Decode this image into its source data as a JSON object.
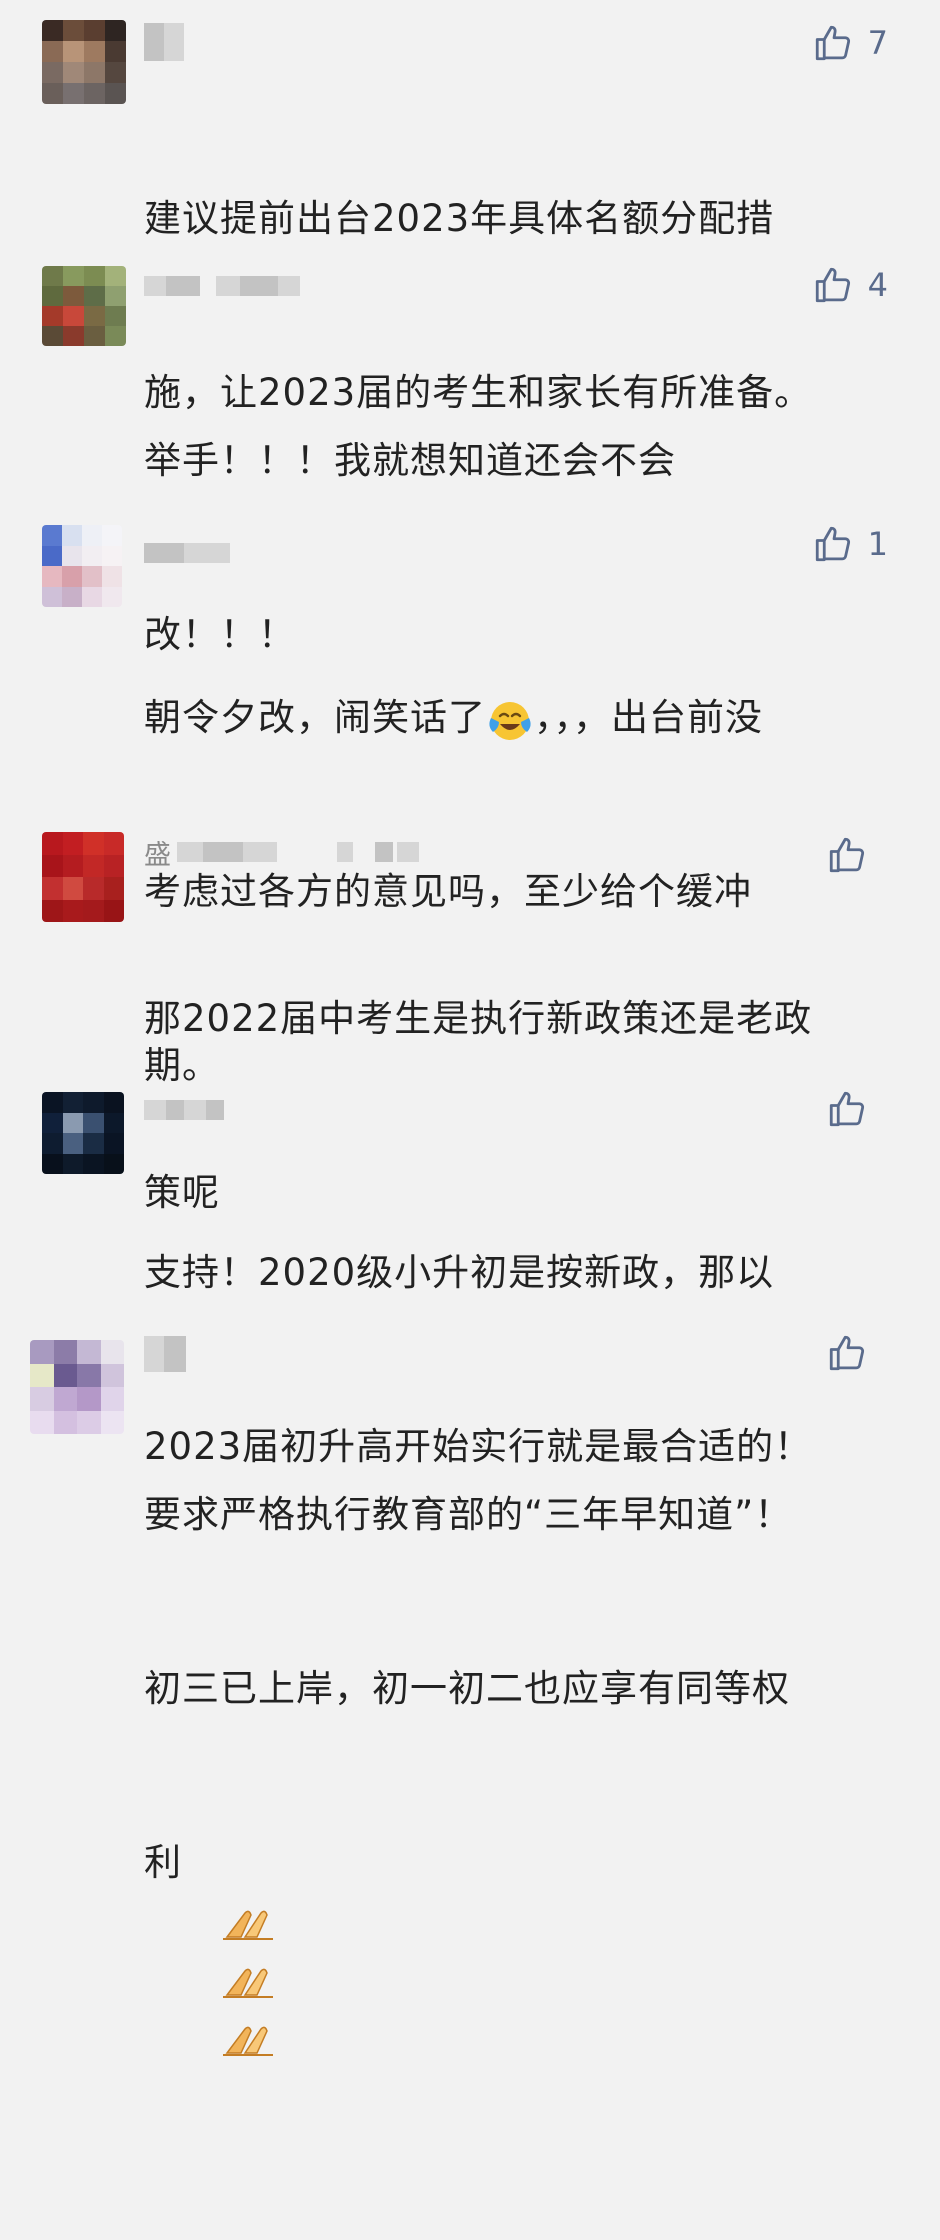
{
  "comments": [
    {
      "likes": "7",
      "lines": [
        "建议提前出台2023年具体名额分配措",
        "施，让2023届的考生和家长有所准备。"
      ]
    },
    {
      "likes": "4",
      "lines": [
        "举手！！！我就想知道还会不会",
        "改！！！"
      ]
    },
    {
      "likes": "1",
      "line1_a": "朝令夕改，闹笑话了",
      "line1_b": "，，，出台前没",
      "line1_emoji": "face-with-tears-of-joy-emoji",
      "lines": [
        "考虑过各方的意见吗，至少给个缓冲",
        "期。"
      ]
    },
    {
      "likes": "",
      "nickname": "盛",
      "lines": [
        "那2022届中考生是执行新政策还是老政",
        "策呢"
      ]
    },
    {
      "likes": "",
      "lines": [
        "支持！2020级小升初是按新政，那以",
        "2023届初升高开始实行就是最合适的！"
      ]
    },
    {
      "likes": "",
      "lines": [
        "要求严格执行教育部的“三年早知道”！",
        "初三已上岸，初一初二也应享有同等权"
      ],
      "last_line": "利",
      "last_emoji": "folded-hands-emoji"
    }
  ],
  "icons": {
    "like": "thumbs-up-icon"
  },
  "colors": {
    "background": "#f2f2f2",
    "like": "#5a6b8c",
    "text": "#222222"
  }
}
